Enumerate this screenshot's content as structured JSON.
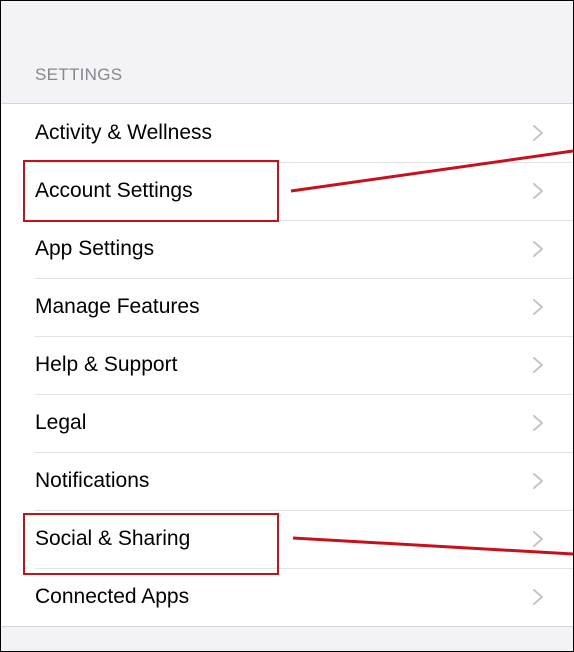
{
  "settings": {
    "section_title": "SETTINGS",
    "items": [
      {
        "label": "Activity & Wellness"
      },
      {
        "label": "Account Settings"
      },
      {
        "label": "App Settings"
      },
      {
        "label": "Manage Features"
      },
      {
        "label": "Help & Support"
      },
      {
        "label": "Legal"
      },
      {
        "label": "Notifications"
      },
      {
        "label": "Social & Sharing"
      },
      {
        "label": "Connected Apps"
      }
    ]
  },
  "colors": {
    "annotation_red": "#c8101c",
    "background": "#f2f2f7",
    "section_text": "#86868b",
    "chevron": "#c4c4c7"
  },
  "icons": {
    "row_disclosure": "chevron-right-icon"
  }
}
